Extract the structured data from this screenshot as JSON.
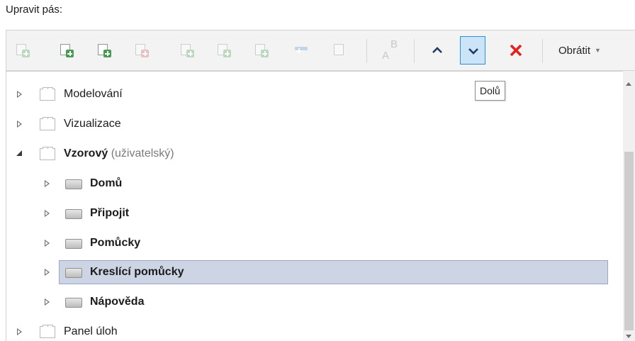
{
  "heading": "Upravit pás:",
  "toolbar": {
    "icons": [
      "new-tab-icon",
      "new-panel-icon",
      "new-slide-panel-icon",
      "insert-image-icon",
      "add-button-icon",
      "add-separator-icon",
      "add-icon",
      "add-dropdown-icon",
      "add-checkbox-icon",
      "rename-icon"
    ],
    "ab_label": "A",
    "ab_sup": "B",
    "obratit_label": "Obrátit",
    "colors": {
      "arrow": "#1f3b63",
      "delete": "#e3221f",
      "pressed_bg": "#cce4f7",
      "pressed_border": "#2b91d6"
    }
  },
  "tooltip": "Dolů",
  "tree": [
    {
      "label": "Modelování",
      "state": "collapsed"
    },
    {
      "label": "Vizualizace",
      "state": "collapsed"
    },
    {
      "label": "Vzorový",
      "suffix": "(uživatelský)",
      "state": "expanded"
    },
    {
      "label": "Domů",
      "state": "collapsed"
    },
    {
      "label": "Připojit",
      "state": "collapsed"
    },
    {
      "label": "Pomůcky",
      "state": "collapsed"
    },
    {
      "label": "Kreslící pomůcky",
      "state": "collapsed",
      "selected": true
    },
    {
      "label": "Nápověda",
      "state": "collapsed"
    },
    {
      "label": "Panel úloh",
      "state": "collapsed"
    }
  ],
  "colors": {
    "selection_bg": "#cdd4e4",
    "selection_border": "#9aa8c6"
  }
}
